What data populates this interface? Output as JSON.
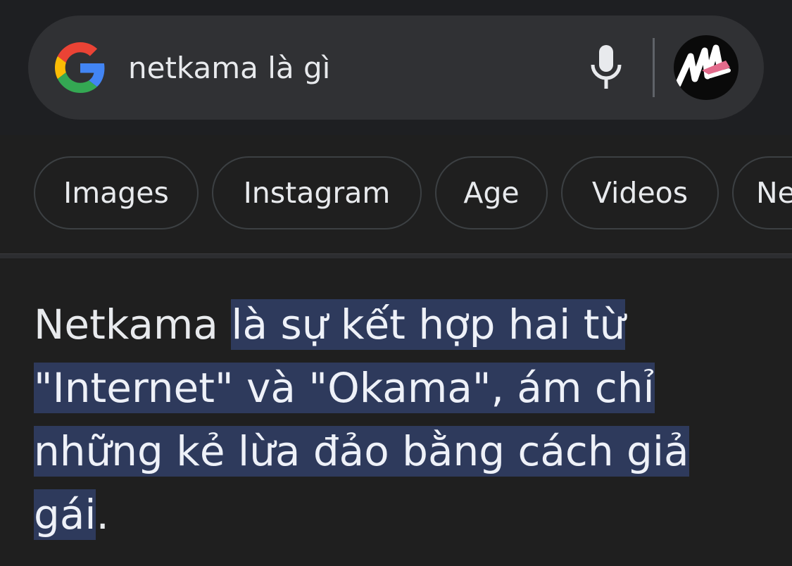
{
  "search": {
    "query": "netkama là gì",
    "logo_icon": "google-g-icon",
    "mic_icon": "microphone-icon",
    "avatar_icon": "profile-avatar"
  },
  "chips": [
    {
      "label": "Images"
    },
    {
      "label": "Instagram"
    },
    {
      "label": "Age"
    },
    {
      "label": "Videos"
    },
    {
      "label": "Ne"
    }
  ],
  "answer": {
    "lead": "Netkama ",
    "line1": "là sự kết hợp hai từ",
    "line2": "\"Internet\" và \"Okama\", ám chỉ",
    "line3": "những kẻ lừa đảo bằng cách giả",
    "line4": "gái",
    "tail": "."
  },
  "colors": {
    "background": "#1f1f1f",
    "search_bar": "#303134",
    "highlight": "#2e3a5c",
    "text": "#e8eaed"
  }
}
